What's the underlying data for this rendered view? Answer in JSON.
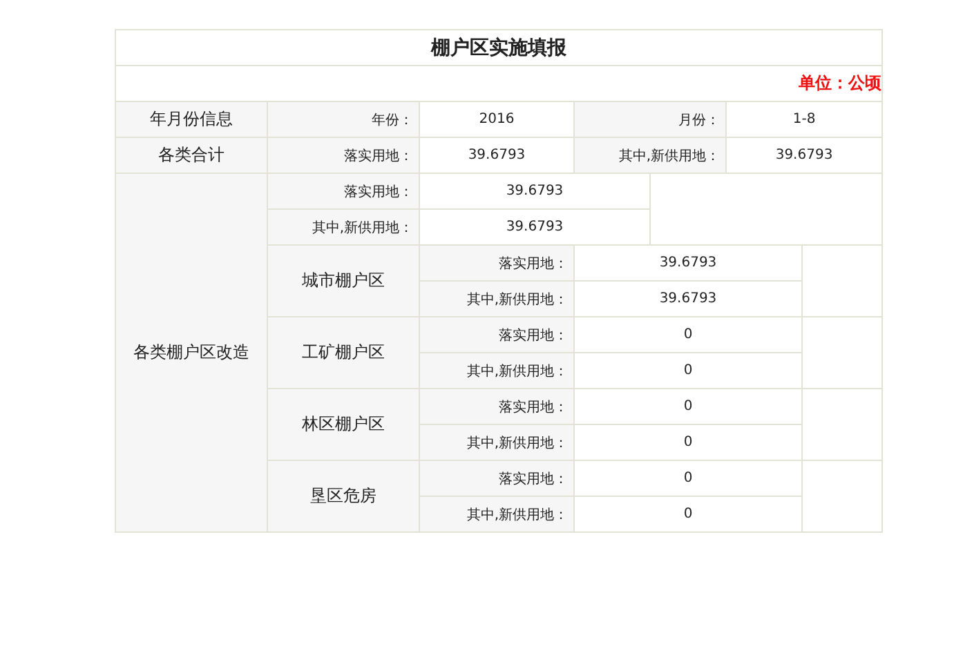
{
  "title": "棚户区实施填报",
  "unit": "单位：公顷",
  "info_rows": [
    {
      "label": "年月份信息",
      "fields": [
        {
          "label": "年份：",
          "value": "2016"
        },
        {
          "label": "月份：",
          "value": "1-8"
        }
      ]
    },
    {
      "label": "各类合计",
      "fields": [
        {
          "label": "落实用地：",
          "value": "39.6793"
        },
        {
          "label": "其中,新供用地：",
          "value": "39.6793"
        }
      ]
    }
  ],
  "reform": {
    "label": "各类棚户区改造",
    "fields": [
      {
        "label": "落实用地：",
        "value": "39.6793"
      },
      {
        "label": "其中,新供用地：",
        "value": "39.6793"
      }
    ],
    "categories": [
      {
        "name": "城市棚户区",
        "fields": [
          {
            "label": "落实用地：",
            "value": "39.6793"
          },
          {
            "label": "其中,新供用地：",
            "value": "39.6793"
          }
        ]
      },
      {
        "name": "工矿棚户区",
        "fields": [
          {
            "label": "落实用地：",
            "value": "0"
          },
          {
            "label": "其中,新供用地：",
            "value": "0"
          }
        ]
      },
      {
        "name": "林区棚户区",
        "fields": [
          {
            "label": "落实用地：",
            "value": "0"
          },
          {
            "label": "其中,新供用地：",
            "value": "0"
          }
        ]
      },
      {
        "name": "垦区危房",
        "fields": [
          {
            "label": "落实用地：",
            "value": "0"
          },
          {
            "label": "其中,新供用地：",
            "value": "0"
          }
        ]
      }
    ]
  }
}
